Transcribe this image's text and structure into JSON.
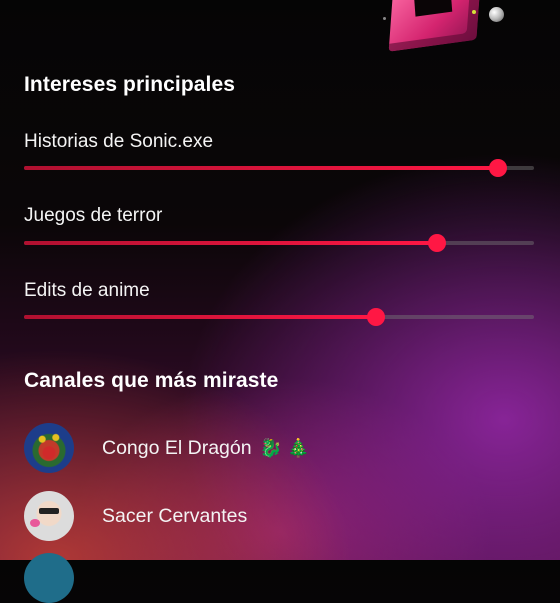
{
  "interests": {
    "title": "Intereses principales",
    "items": [
      {
        "label": "Historias de Sonic.exe",
        "level": 0.93
      },
      {
        "label": "Juegos de terror",
        "level": 0.81
      },
      {
        "label": "Edits de anime",
        "level": 0.69
      }
    ]
  },
  "channels": {
    "title": "Canales que más miraste",
    "items": [
      {
        "name": "Congo El Dragón",
        "emoji": "🐉 🎄"
      },
      {
        "name": "Sacer Cervantes",
        "emoji": ""
      }
    ]
  },
  "colors": {
    "accent": "#ff1744",
    "track": "#5a5a5a"
  }
}
